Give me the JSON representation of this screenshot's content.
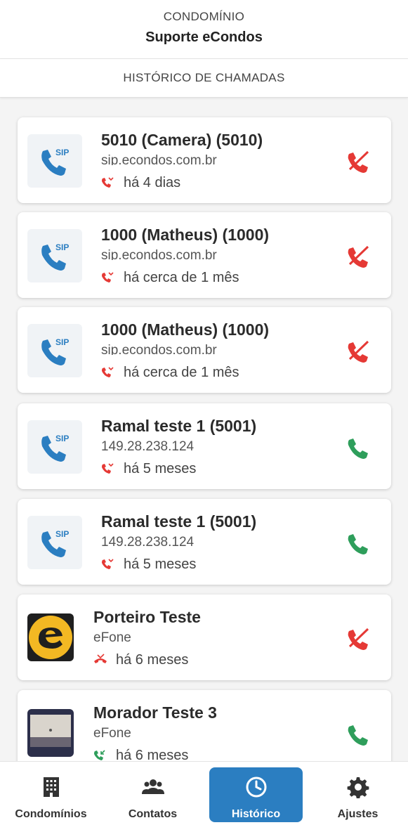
{
  "header": {
    "subtitle": "CONDOMÍNIO",
    "title": "Suporte eCondos"
  },
  "tab": {
    "label": "HISTÓRICO DE CHAMADAS"
  },
  "calls": [
    {
      "name": "5010 (Camera) (5010)",
      "sub": "sip.econdos.com.br",
      "when": "há 4 dias",
      "avatar": "sip-icon",
      "status": "missed"
    },
    {
      "name": "1000 (Matheus) (1000)",
      "sub": "sip.econdos.com.br",
      "when": "há cerca de 1 mês",
      "avatar": "sip-icon",
      "status": "missed"
    },
    {
      "name": "1000 (Matheus) (1000)",
      "sub": "sip.econdos.com.br",
      "when": "há cerca de 1 mês",
      "avatar": "sip-icon",
      "status": "missed"
    },
    {
      "name": "Ramal teste 1 (5001)",
      "sub": "149.28.238.124",
      "when": "há 5 meses",
      "avatar": "sip-icon",
      "status": "answered"
    },
    {
      "name": "Ramal teste 1 (5001)",
      "sub": "149.28.238.124",
      "when": "há 5 meses",
      "avatar": "sip-icon",
      "status": "answered"
    },
    {
      "name": "Porteiro Teste",
      "sub": "eFone",
      "when": "há 6 meses",
      "avatar": "efone-logo",
      "status": "missed"
    },
    {
      "name": "Morador Teste 3",
      "sub": "eFone",
      "when": "há 6 meses",
      "avatar": "user-photo",
      "status": "answered"
    }
  ],
  "nav": [
    {
      "label": "Condomínios",
      "icon": "building-icon"
    },
    {
      "label": "Contatos",
      "icon": "contacts-icon"
    },
    {
      "label": "Histórico",
      "icon": "clock-icon",
      "active": true
    },
    {
      "label": "Ajustes",
      "icon": "gear-icon"
    }
  ],
  "colors": {
    "primary": "#2b7ec1",
    "missed": "#e53935",
    "answered": "#2e9e5b",
    "sip": "#2b7ec1"
  }
}
